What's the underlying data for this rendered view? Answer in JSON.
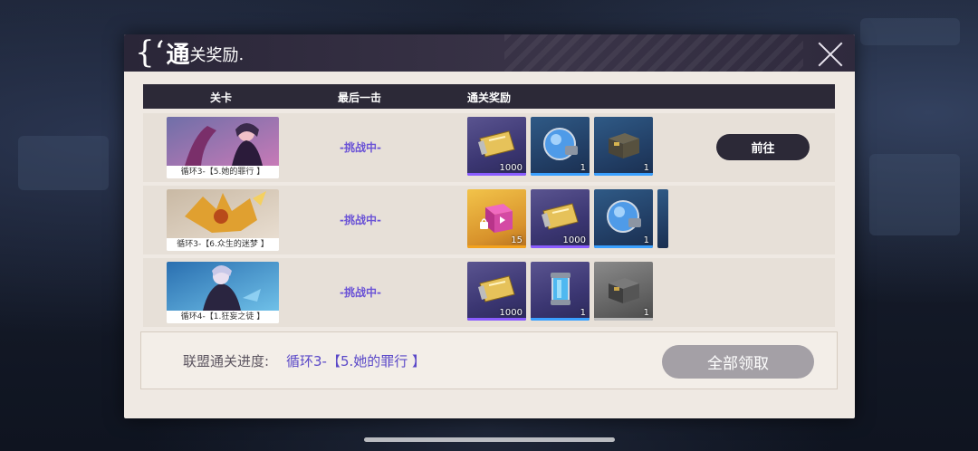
{
  "dialog": {
    "title_bracket": "{‘",
    "title_big": "通",
    "title_small": "关奖励",
    "title_dot": "."
  },
  "table": {
    "headers": [
      "关卡",
      "最后一击",
      "通关奖励"
    ]
  },
  "rows": [
    {
      "stage": "循环3-【5.她的罪行 】",
      "status": "-挑战中-",
      "button": "前往",
      "rewards": [
        {
          "icon": "ticket-icon",
          "count": "1000",
          "rarity": "purple"
        },
        {
          "icon": "energy-orb-icon",
          "count": "1",
          "rarity": "blue"
        },
        {
          "icon": "supply-crate-icon",
          "count": "1",
          "rarity": "blue"
        }
      ]
    },
    {
      "stage": "循环3-【6.众生的迷梦 】",
      "status": "-挑战中-",
      "rewards": [
        {
          "icon": "locked-gift-box-icon",
          "count": "15",
          "rarity": "gold"
        },
        {
          "icon": "ticket-icon",
          "count": "1000",
          "rarity": "purple"
        },
        {
          "icon": "energy-orb-icon",
          "count": "1",
          "rarity": "blue"
        }
      ]
    },
    {
      "stage": "循环4-【1.狂妄之徒 】",
      "status": "-挑战中-",
      "rewards": [
        {
          "icon": "ticket-icon",
          "count": "1000",
          "rarity": "purple"
        },
        {
          "icon": "energy-canister-icon",
          "count": "1",
          "rarity": "blue"
        },
        {
          "icon": "supply-crate-icon",
          "count": "1",
          "rarity": "gray"
        }
      ]
    }
  ],
  "progress": {
    "label": "联盟通关进度:",
    "value": "循环3-【5.她的罪行 】",
    "claim_all": "全部领取"
  },
  "colors": {
    "accent": "#6a52d6",
    "header_dark": "#2c2937",
    "panel": "#efe9e3"
  }
}
